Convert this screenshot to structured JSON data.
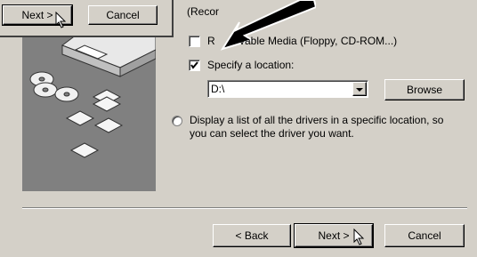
{
  "header": {
    "partial_text": "(Recor"
  },
  "popup": {
    "next_label": "Next >",
    "cancel_label": "Cancel"
  },
  "options": {
    "removable_media_label_start": "R",
    "removable_media_label_end": "vable Media (Floppy, CD-ROM...)",
    "removable_media_checked": false,
    "specify_location_label": "Specify a location:",
    "specify_location_checked": true,
    "location_value": "D:\\",
    "browse_label": "Browse",
    "display_list_label": "Display a list of all the drivers in a specific location, so you can select the driver you want.",
    "display_list_line1": "Display a list of all the drivers in a specific location, so",
    "display_list_line2": "you can select the driver you want.",
    "display_list_selected": false
  },
  "footer": {
    "back_label": "< Back",
    "next_label": "Next >",
    "cancel_label": "Cancel"
  },
  "colors": {
    "dialog_bg": "#d4d0c8",
    "illustration_bg": "#808080",
    "pointer_arrow": "#000000"
  }
}
